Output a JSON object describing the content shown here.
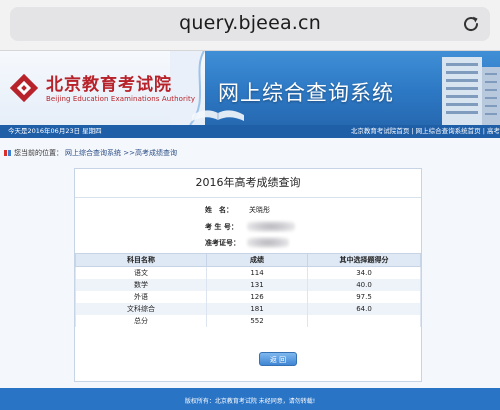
{
  "browser": {
    "url": "query.bjeea.cn",
    "reload_icon": "reload-icon"
  },
  "header": {
    "logo_cn": "北京教育考试院",
    "logo_en": "Beijing Education Examinations Authority",
    "system_title": "网上综合查询系统"
  },
  "datebar": {
    "date_text": "今天是2016年06月23日 星期四",
    "links": "北京教育考试院首页 | 网上综合查询系统首页 | 高考"
  },
  "breadcrumb": {
    "label": "您当前的位置：",
    "path": "网上综合查询系统 >>高考成绩查询"
  },
  "result": {
    "title": "2016年高考成绩查询",
    "name_label": "姓　名：",
    "name_value": "关晓彤",
    "exam_no_label": "考 生 号：",
    "ticket_label": "准考证号：",
    "columns": [
      "科目名称",
      "成绩",
      "其中选择题得分"
    ],
    "rows": [
      [
        "语文",
        "114",
        "34.0"
      ],
      [
        "数学",
        "131",
        "40.0"
      ],
      [
        "外语",
        "126",
        "97.5"
      ],
      [
        "文科综合",
        "181",
        "64.0"
      ],
      [
        "总分",
        "552",
        ""
      ]
    ],
    "back_label": "返 回"
  },
  "footer": {
    "line1": "版权所有：北京教育考试院  未经同意，请勿转载!"
  },
  "colors": {
    "brand_blue": "#2d78c4",
    "logo_red": "#b8222a"
  }
}
